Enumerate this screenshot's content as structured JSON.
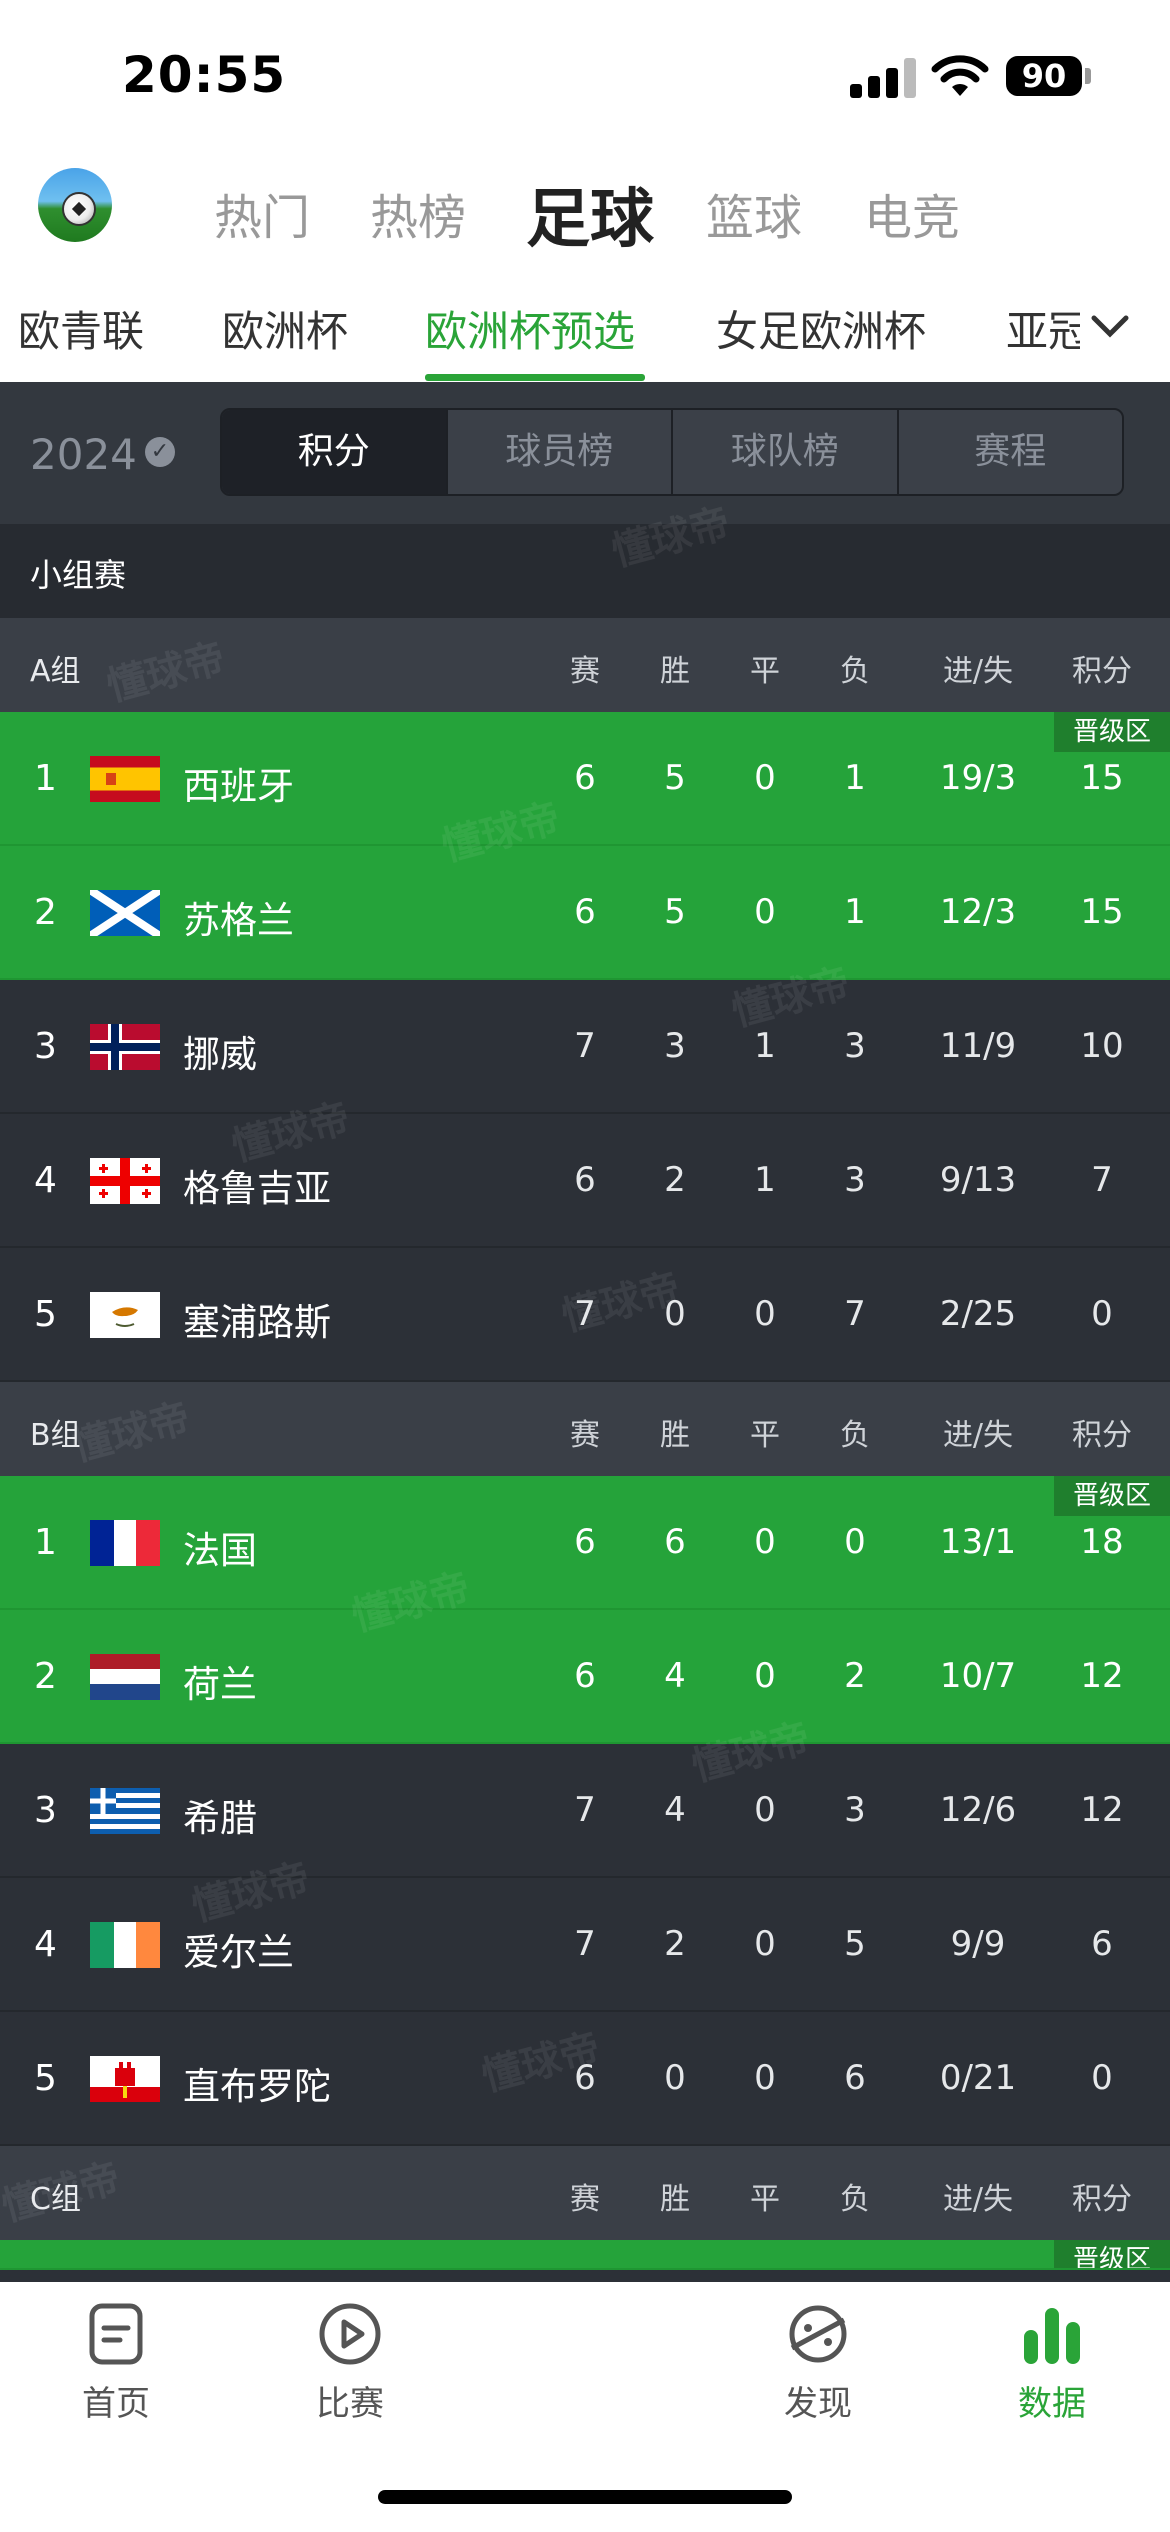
{
  "status_bar": {
    "time": "20:55",
    "battery": "90"
  },
  "top_tabs": [
    {
      "label": "热门",
      "active": false
    },
    {
      "label": "热榜",
      "active": false
    },
    {
      "label": "足球",
      "active": true
    },
    {
      "label": "篮球",
      "active": false
    },
    {
      "label": "电竞",
      "active": false
    }
  ],
  "sub_tabs": [
    {
      "label": "欧青联",
      "active": false
    },
    {
      "label": "欧洲杯",
      "active": false
    },
    {
      "label": "欧洲杯预选",
      "active": true
    },
    {
      "label": "女足欧洲杯",
      "active": false
    },
    {
      "label": "亚冠",
      "active": false
    }
  ],
  "filter": {
    "year": "2024",
    "segments": [
      {
        "label": "积分",
        "active": true
      },
      {
        "label": "球员榜",
        "active": false
      },
      {
        "label": "球队榜",
        "active": false
      },
      {
        "label": "赛程",
        "active": false
      }
    ]
  },
  "section_title": "小组赛",
  "columns": [
    "赛",
    "胜",
    "平",
    "负",
    "进/失",
    "积分"
  ],
  "qualify_badge": "晋级区",
  "groups": [
    {
      "name": "A组",
      "rows": [
        {
          "rank": "1",
          "team": "西班牙",
          "flag": "spain",
          "p": "6",
          "w": "5",
          "d": "0",
          "l": "1",
          "gf_ga": "19/3",
          "pts": "15",
          "qualified": true
        },
        {
          "rank": "2",
          "team": "苏格兰",
          "flag": "scotland",
          "p": "6",
          "w": "5",
          "d": "0",
          "l": "1",
          "gf_ga": "12/3",
          "pts": "15",
          "qualified": true
        },
        {
          "rank": "3",
          "team": "挪威",
          "flag": "norway",
          "p": "7",
          "w": "3",
          "d": "1",
          "l": "3",
          "gf_ga": "11/9",
          "pts": "10",
          "qualified": false
        },
        {
          "rank": "4",
          "team": "格鲁吉亚",
          "flag": "georgia",
          "p": "6",
          "w": "2",
          "d": "1",
          "l": "3",
          "gf_ga": "9/13",
          "pts": "7",
          "qualified": false
        },
        {
          "rank": "5",
          "team": "塞浦路斯",
          "flag": "cyprus",
          "p": "7",
          "w": "0",
          "d": "0",
          "l": "7",
          "gf_ga": "2/25",
          "pts": "0",
          "qualified": false
        }
      ]
    },
    {
      "name": "B组",
      "rows": [
        {
          "rank": "1",
          "team": "法国",
          "flag": "france",
          "p": "6",
          "w": "6",
          "d": "0",
          "l": "0",
          "gf_ga": "13/1",
          "pts": "18",
          "qualified": true
        },
        {
          "rank": "2",
          "team": "荷兰",
          "flag": "netherlands",
          "p": "6",
          "w": "4",
          "d": "0",
          "l": "2",
          "gf_ga": "10/7",
          "pts": "12",
          "qualified": true
        },
        {
          "rank": "3",
          "team": "希腊",
          "flag": "greece",
          "p": "7",
          "w": "4",
          "d": "0",
          "l": "3",
          "gf_ga": "12/6",
          "pts": "12",
          "qualified": false
        },
        {
          "rank": "4",
          "team": "爱尔兰",
          "flag": "ireland",
          "p": "7",
          "w": "2",
          "d": "0",
          "l": "5",
          "gf_ga": "9/9",
          "pts": "6",
          "qualified": false
        },
        {
          "rank": "5",
          "team": "直布罗陀",
          "flag": "gibraltar",
          "p": "6",
          "w": "0",
          "d": "0",
          "l": "6",
          "gf_ga": "0/21",
          "pts": "0",
          "qualified": false
        }
      ]
    },
    {
      "name": "C组",
      "rows": []
    }
  ],
  "watermark": "懂球帝",
  "tab_bar": [
    {
      "label": "首页",
      "icon": "document-icon",
      "active": false
    },
    {
      "label": "比赛",
      "icon": "play-icon",
      "active": false
    },
    {
      "label": "发现",
      "icon": "planet-icon",
      "active": false
    },
    {
      "label": "数据",
      "icon": "bar-chart-icon",
      "active": true
    }
  ],
  "colors": {
    "accent": "#2aa438",
    "qualified_row": "#25a33a",
    "dark_bg": "#2c3037"
  }
}
